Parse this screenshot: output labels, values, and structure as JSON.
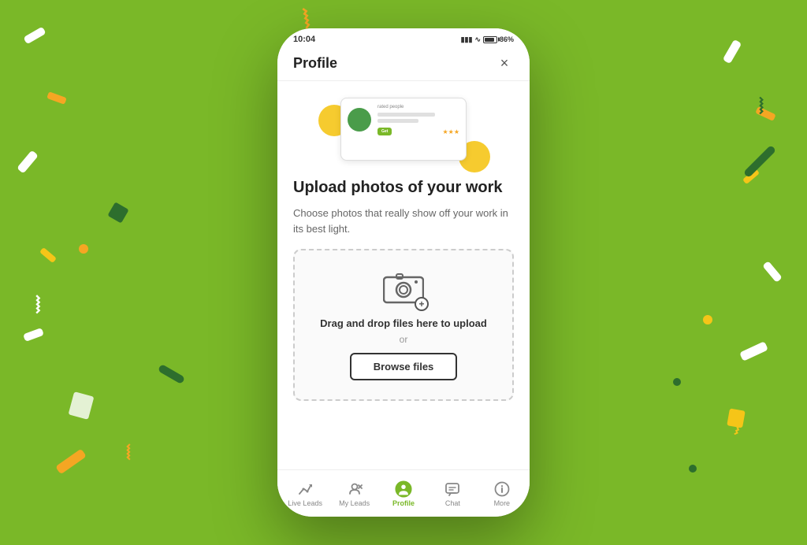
{
  "background": {
    "color": "#7ab828"
  },
  "status_bar": {
    "time": "10:04",
    "battery": "86%"
  },
  "header": {
    "title": "Profile",
    "close_label": "×"
  },
  "profile_card": {
    "brand": "rated people",
    "button_label": "Get",
    "stars": "★★★"
  },
  "upload_section": {
    "title": "Upload photos of your work",
    "subtitle": "Choose photos that really show off your work in its best light.",
    "drag_drop_text": "Drag and drop files here to upload",
    "or_text": "or",
    "browse_label": "Browse files"
  },
  "bottom_nav": {
    "items": [
      {
        "id": "live-leads",
        "label": "Live Leads",
        "active": false
      },
      {
        "id": "my-leads",
        "label": "My Leads",
        "active": false
      },
      {
        "id": "profile",
        "label": "Profile",
        "active": true
      },
      {
        "id": "chat",
        "label": "Chat",
        "active": false
      },
      {
        "id": "more",
        "label": "More",
        "active": false
      }
    ]
  }
}
